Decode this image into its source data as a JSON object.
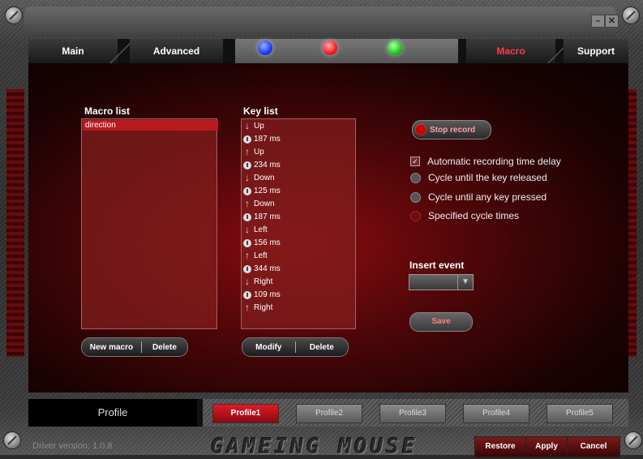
{
  "window": {
    "minimize_glyph": "–",
    "close_glyph": "✕"
  },
  "tabs": {
    "main": "Main",
    "advanced": "Advanced",
    "macro": "Macro",
    "support": "Support",
    "leds": [
      {
        "name": "blue-led",
        "color": "#1a3cff"
      },
      {
        "name": "red-led",
        "color": "#ff1a1a"
      },
      {
        "name": "green-led",
        "color": "#1acc1a"
      }
    ]
  },
  "macro_list": {
    "title": "Macro list",
    "items": [
      "direction"
    ],
    "new_button": "New macro",
    "delete_button": "Delete"
  },
  "key_list": {
    "title": "Key list",
    "items": [
      {
        "icon": "down-arrow-icon",
        "text": "Up"
      },
      {
        "icon": "timer-icon",
        "text": "187 ms"
      },
      {
        "icon": "up-arrow-icon",
        "text": "Up"
      },
      {
        "icon": "timer-icon",
        "text": "234 ms"
      },
      {
        "icon": "down-arrow-icon",
        "text": "Down"
      },
      {
        "icon": "timer-icon",
        "text": "125 ms"
      },
      {
        "icon": "up-arrow-icon",
        "text": "Down"
      },
      {
        "icon": "timer-icon",
        "text": "187 ms"
      },
      {
        "icon": "down-arrow-icon",
        "text": "Left"
      },
      {
        "icon": "timer-icon",
        "text": "156 ms"
      },
      {
        "icon": "up-arrow-icon",
        "text": "Left"
      },
      {
        "icon": "timer-icon",
        "text": "344 ms"
      },
      {
        "icon": "down-arrow-icon",
        "text": "Right"
      },
      {
        "icon": "timer-icon",
        "text": "109 ms"
      },
      {
        "icon": "up-arrow-icon",
        "text": "Right"
      }
    ],
    "modify_button": "Modify",
    "delete_button": "Delete"
  },
  "record": {
    "stop_button": "Stop record",
    "options": [
      {
        "type": "checkbox",
        "label": "Automatic recording time delay",
        "checked": true
      },
      {
        "type": "radio",
        "label": "Cycle until the key released",
        "selected": false
      },
      {
        "type": "radio",
        "label": "Cycle until any key pressed",
        "selected": false
      },
      {
        "type": "radio",
        "label": "Specified cycle times",
        "selected": true
      }
    ],
    "insert_event_label": "Insert event",
    "insert_event_value": "",
    "save_button": "Save"
  },
  "profile": {
    "label": "Profile",
    "buttons": [
      "Profile1",
      "Profile2",
      "Profile3",
      "Profile4",
      "Profile5"
    ],
    "active": "Profile1"
  },
  "footer": {
    "driver_version": "Driver version:  1.0.8",
    "brand": "GAMEING MOUSE",
    "restore": "Restore",
    "apply": "Apply",
    "cancel": "Cancel"
  },
  "colors": {
    "accent_red": "#e01a24",
    "tab_active": "#ff3a4a",
    "panel_red": "#8a0c12"
  }
}
